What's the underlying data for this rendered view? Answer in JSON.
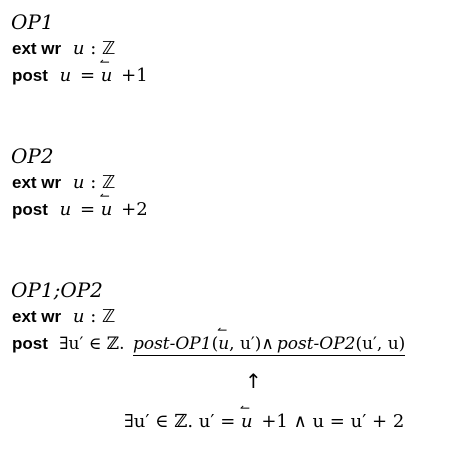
{
  "blocks": [
    {
      "name": "OP1",
      "ext_keyword": "ext wr",
      "ext_var": "u",
      "ext_colon": ":",
      "ext_type": "ℤ",
      "post_keyword": "post",
      "post_lhs": "u",
      "post_eq": "=",
      "post_var": "u",
      "post_rhs": "+1"
    },
    {
      "name": "OP2",
      "ext_keyword": "ext wr",
      "ext_var": "u",
      "ext_colon": ":",
      "ext_type": "ℤ",
      "post_keyword": "post",
      "post_lhs": "u",
      "post_eq": "=",
      "post_var": "u",
      "post_rhs": "+2"
    },
    {
      "name": "OP1;OP2",
      "ext_keyword": "ext wr",
      "ext_var": "u",
      "ext_colon": ":",
      "ext_type": "ℤ",
      "post_keyword": "post",
      "post_quant": "∃u′ ∈ ℤ.",
      "post_op1": "post-OP1",
      "post_op1_args_open": "(",
      "post_op1_var": "u",
      "post_op1_args_rest": ", u′)",
      "post_and": "∧",
      "post_op2": "post-OP2",
      "post_op2_args": "(u′, u)"
    }
  ],
  "arrow": "↑",
  "result": {
    "quant": "∃u′ ∈ ℤ. u′ =",
    "var": "u",
    "rest": "+1 ∧ u = u′ + 2"
  },
  "hook_glyph": "↼"
}
